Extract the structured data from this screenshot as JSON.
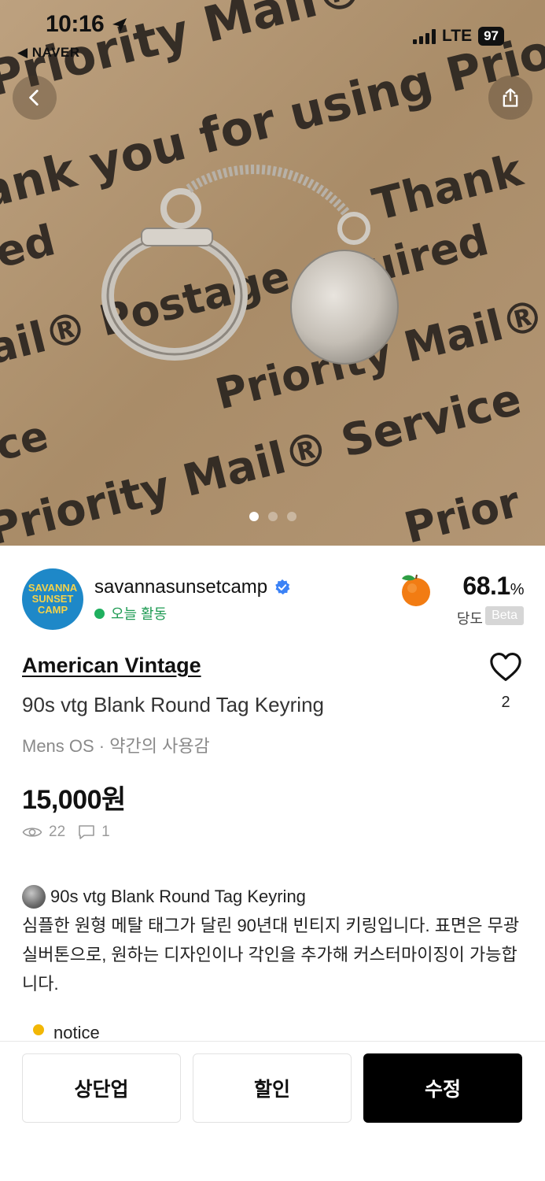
{
  "status_bar": {
    "time": "10:16",
    "back_app": "◀ NAVER",
    "network": "LTE",
    "battery": "97"
  },
  "hero": {
    "image_description_icon": "product-photo",
    "box_text": [
      "Priority Mail® Service",
      "Thank you for using Priority",
      "Postage Required"
    ],
    "page_indicator": {
      "total": 3,
      "active": 1
    }
  },
  "seller": {
    "avatar_text": "SAVANNA\nSUNSET\nCAMP",
    "name": "savannasunsetcamp",
    "activity": "오늘 활동",
    "sweetness_value": "68.1",
    "sweetness_unit": "%",
    "sweetness_label": "당도",
    "beta_label": "Beta"
  },
  "item": {
    "brand": "American Vintage",
    "title": "90s vtg Blank Round Tag Keyring",
    "meta": "Mens OS · 약간의 사용감",
    "price": "15,000원",
    "likes": "2",
    "views": "22",
    "comments": "1"
  },
  "description": {
    "title": "90s vtg Blank Round Tag Keyring",
    "body": "심플한 원형 메탈 태그가 달린 90년대 빈티지 키링입니다. 표면은 무광 실버톤으로, 원하는 디자인이나 각인을 추가해 커스터마이징이 가능합니다.",
    "notice": "notice"
  },
  "actions": {
    "bump": "상단업",
    "discount": "할인",
    "edit": "수정"
  },
  "colors": {
    "active_green": "#1fb05f",
    "avatar_blue": "#1e88c8",
    "primary_button": "#000000"
  }
}
